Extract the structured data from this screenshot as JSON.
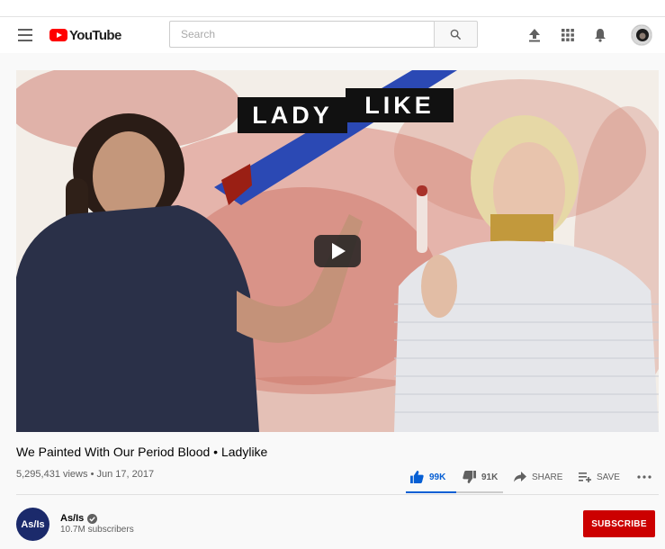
{
  "header": {
    "logo_text": "YouTube",
    "search_placeholder": "Search"
  },
  "video": {
    "overlay_title_left": "LADY",
    "overlay_title_right": "LIKE",
    "title": "We Painted With Our Period Blood • Ladylike",
    "views": "5,295,431 views",
    "date": "Jun 17, 2017",
    "likes": "99K",
    "dislikes": "91K",
    "share_label": "SHARE",
    "save_label": "SAVE",
    "like_ratio": 0.52
  },
  "channel": {
    "avatar_text": "As/Is",
    "name": "As/Is",
    "subscribers": "10.7M subscribers",
    "subscribe_label": "SUBSCRIBE"
  },
  "colors": {
    "brand_red": "#ff0000",
    "subscribe_red": "#cc0000",
    "like_blue": "#065fd4"
  }
}
